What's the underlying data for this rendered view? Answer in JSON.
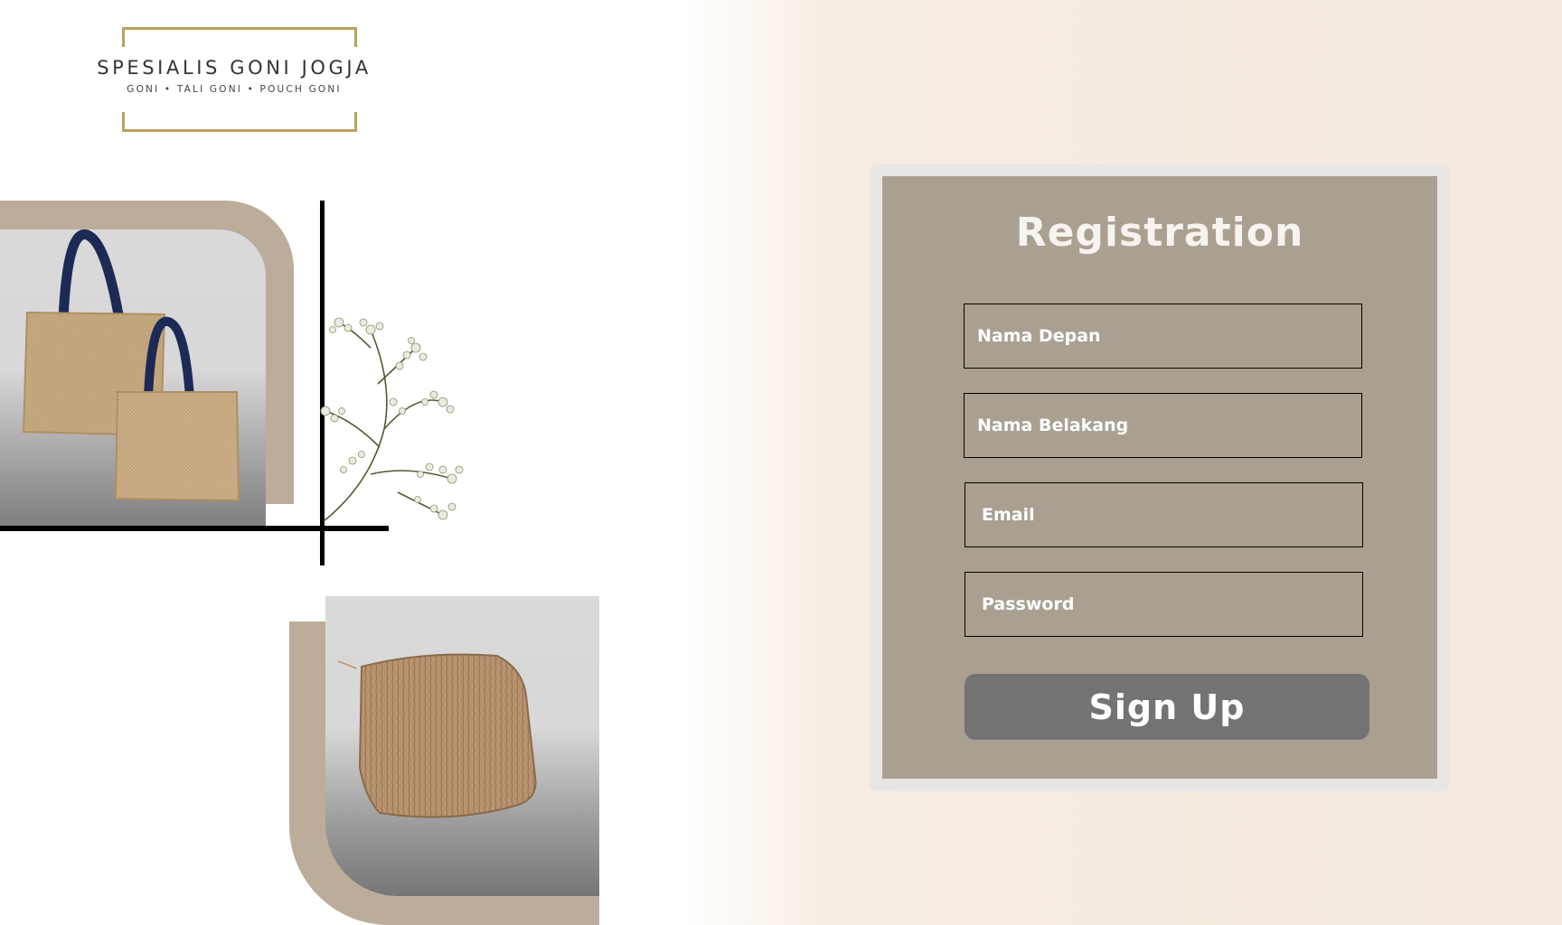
{
  "brand": {
    "title": "SPESIALIS GONI JOGJA",
    "subtitle": "GONI • TALI GONI • POUCH GONI",
    "accent_color": "#b9a25e"
  },
  "decor": {
    "tan_color": "#bcad9b",
    "images": [
      {
        "name": "jute-tote-bags-photo"
      },
      {
        "name": "baby-breath-flower"
      },
      {
        "name": "jute-fiber-pouch-photo"
      }
    ]
  },
  "form": {
    "title": "Registration",
    "panel_color": "#aaa091",
    "fields": {
      "first_name": {
        "placeholder": "Nama Depan",
        "value": ""
      },
      "last_name": {
        "placeholder": "Nama Belakang",
        "value": ""
      },
      "email": {
        "placeholder": "Email",
        "value": ""
      },
      "password": {
        "placeholder": "Password",
        "value": ""
      }
    },
    "submit_label": "Sign Up",
    "button_color": "#737373"
  }
}
